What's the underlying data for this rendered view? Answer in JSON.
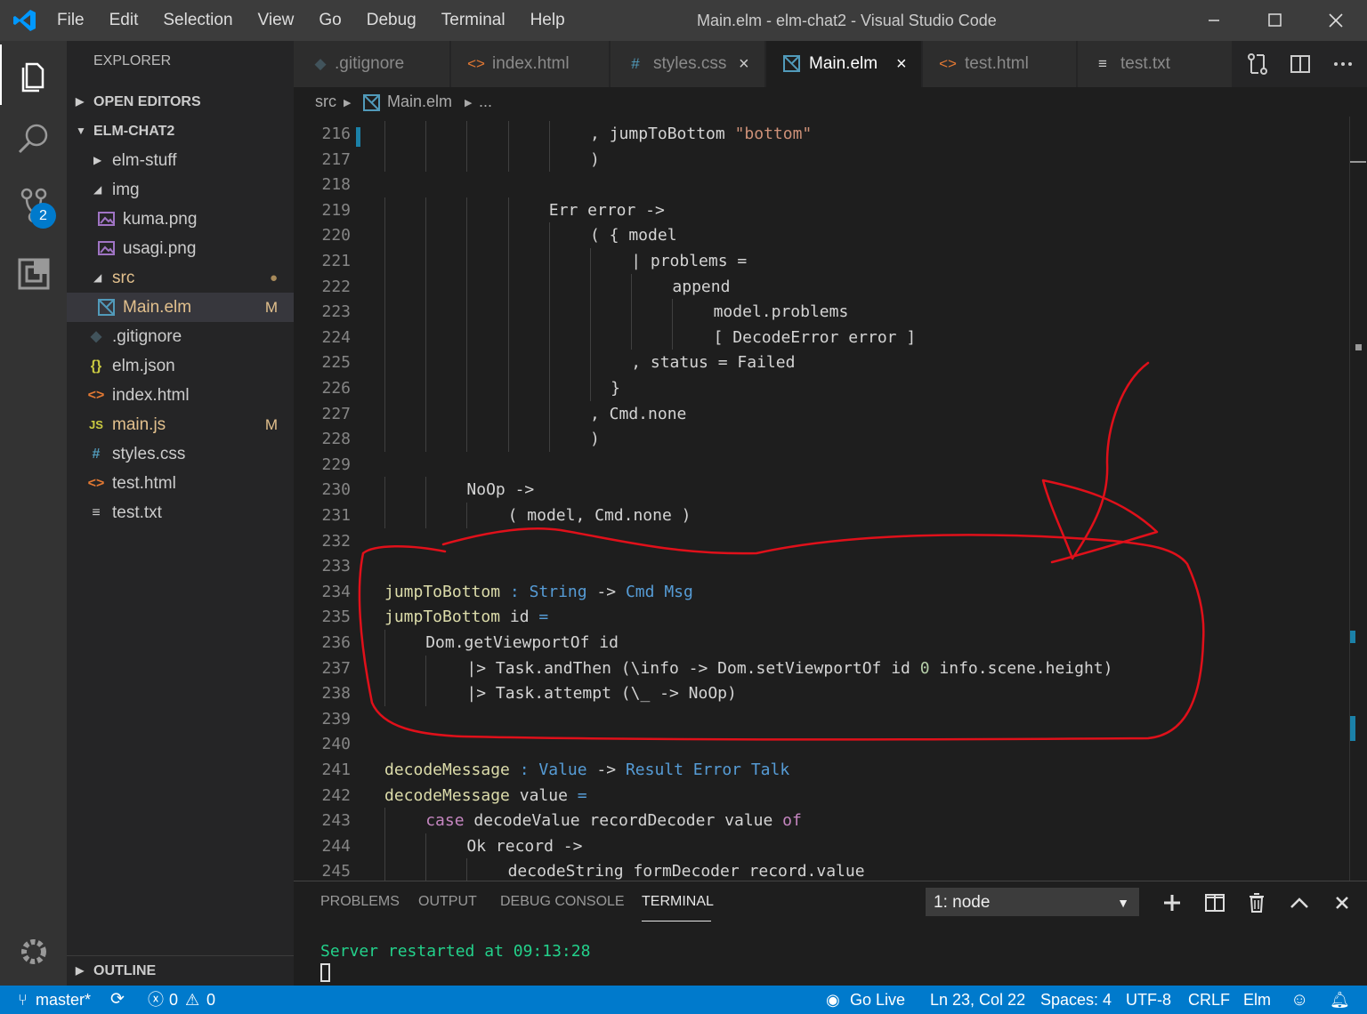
{
  "window": {
    "title": "Main.elm - elm-chat2 - Visual Studio Code"
  },
  "menu": [
    "File",
    "Edit",
    "Selection",
    "View",
    "Go",
    "Debug",
    "Terminal",
    "Help"
  ],
  "activity": {
    "scm_badge": "2"
  },
  "sidebar": {
    "header": "EXPLORER",
    "open_editors": "OPEN EDITORS",
    "project": "ELM-CHAT2",
    "outline": "OUTLINE",
    "tree": [
      {
        "name": "elm-stuff",
        "icon": "folder"
      },
      {
        "name": "img",
        "icon": "folder-open"
      },
      {
        "name": "kuma.png",
        "icon": "image-icon"
      },
      {
        "name": "usagi.png",
        "icon": "image-icon"
      },
      {
        "name": "src",
        "icon": "folder-open",
        "status": "●"
      },
      {
        "name": "Main.elm",
        "icon": "elm-icon",
        "status": "M"
      },
      {
        "name": ".gitignore",
        "icon": "git-icon"
      },
      {
        "name": "elm.json",
        "icon": "json-icon",
        "glyph": "{}"
      },
      {
        "name": "index.html",
        "icon": "html-icon",
        "glyph": "<>"
      },
      {
        "name": "main.js",
        "icon": "js-icon",
        "glyph": "JS",
        "status": "M"
      },
      {
        "name": "styles.css",
        "icon": "css-icon",
        "glyph": "#"
      },
      {
        "name": "test.html",
        "icon": "html-icon",
        "glyph": "<>"
      },
      {
        "name": "test.txt",
        "icon": "text-icon",
        "glyph": "≡"
      }
    ]
  },
  "tabs": [
    {
      "label": ".gitignore",
      "glyph": "◆"
    },
    {
      "label": "index.html",
      "glyph": "<>"
    },
    {
      "label": "styles.css",
      "glyph": "#",
      "close": "×"
    },
    {
      "label": "Main.elm",
      "glyph": "",
      "close": "×"
    },
    {
      "label": "test.html",
      "glyph": "<>"
    },
    {
      "label": "test.txt",
      "glyph": "≡"
    }
  ],
  "breadcrumb": {
    "folder": "src",
    "file": "Main.elm",
    "more": "..."
  },
  "editor": {
    "lines": [
      {
        "n": "216",
        "indent": 10,
        "parts": [
          [
            ", ",
            ""
          ],
          [
            "jumpToBottom",
            ""
          ],
          [
            " ",
            ""
          ],
          [
            "\"bottom\"",
            "s"
          ]
        ]
      },
      {
        "n": "217",
        "indent": 10,
        "parts": [
          [
            ")",
            ""
          ]
        ]
      },
      {
        "n": "218",
        "indent": 0,
        "parts": []
      },
      {
        "n": "219",
        "indent": 8,
        "parts": [
          [
            "Err",
            ""
          ],
          [
            " error ->",
            ""
          ]
        ]
      },
      {
        "n": "220",
        "indent": 10,
        "parts": [
          [
            "( { model",
            ""
          ]
        ]
      },
      {
        "n": "221",
        "indent": 12,
        "parts": [
          [
            "| problems =",
            ""
          ]
        ]
      },
      {
        "n": "222",
        "indent": 14,
        "parts": [
          [
            "append",
            ""
          ]
        ]
      },
      {
        "n": "223",
        "indent": 16,
        "parts": [
          [
            "model.problems",
            ""
          ]
        ]
      },
      {
        "n": "224",
        "indent": 16,
        "parts": [
          [
            "[ DecodeError error ]",
            ""
          ]
        ]
      },
      {
        "n": "225",
        "indent": 12,
        "parts": [
          [
            ", status = Failed",
            ""
          ]
        ]
      },
      {
        "n": "226",
        "indent": 11,
        "parts": [
          [
            "}",
            ""
          ]
        ]
      },
      {
        "n": "227",
        "indent": 10,
        "parts": [
          [
            ", Cmd.none",
            ""
          ]
        ]
      },
      {
        "n": "228",
        "indent": 10,
        "parts": [
          [
            ")",
            ""
          ]
        ]
      },
      {
        "n": "229",
        "indent": 0,
        "parts": []
      },
      {
        "n": "230",
        "indent": 4,
        "parts": [
          [
            "NoOp ->",
            ""
          ]
        ]
      },
      {
        "n": "231",
        "indent": 6,
        "parts": [
          [
            "( model, Cmd.none )",
            ""
          ]
        ]
      },
      {
        "n": "232",
        "indent": 0,
        "parts": []
      },
      {
        "n": "233",
        "indent": 0,
        "parts": []
      },
      {
        "n": "234",
        "indent": 0,
        "parts": [
          [
            "jumpToBottom",
            "f"
          ],
          [
            " : ",
            "ty"
          ],
          [
            "String",
            "ty"
          ],
          [
            " -> ",
            ""
          ],
          [
            "Cmd",
            "ty"
          ],
          [
            " ",
            ""
          ],
          [
            "Msg",
            "ty"
          ]
        ]
      },
      {
        "n": "235",
        "indent": 0,
        "parts": [
          [
            "jumpToBottom",
            "f"
          ],
          [
            " id ",
            ""
          ],
          [
            "=",
            "ty"
          ]
        ]
      },
      {
        "n": "236",
        "indent": 2,
        "parts": [
          [
            "Dom.getViewportOf id",
            ""
          ]
        ]
      },
      {
        "n": "237",
        "indent": 4,
        "parts": [
          [
            "|> Task.andThen (\\info -> Dom.setViewportOf id ",
            ""
          ],
          [
            "0",
            "n"
          ],
          [
            " info.scene.height)",
            ""
          ]
        ]
      },
      {
        "n": "238",
        "indent": 4,
        "parts": [
          [
            "|> Task.attempt (\\_ -> NoOp)",
            ""
          ]
        ]
      },
      {
        "n": "239",
        "indent": 0,
        "parts": []
      },
      {
        "n": "240",
        "indent": 0,
        "parts": []
      },
      {
        "n": "241",
        "indent": 0,
        "parts": [
          [
            "decodeMessage",
            "f"
          ],
          [
            " : ",
            "ty"
          ],
          [
            "Value",
            "ty"
          ],
          [
            " -> ",
            ""
          ],
          [
            "Result Error Talk",
            "ty"
          ]
        ]
      },
      {
        "n": "242",
        "indent": 0,
        "parts": [
          [
            "decodeMessage",
            "f"
          ],
          [
            " value ",
            ""
          ],
          [
            "=",
            "ty"
          ]
        ]
      },
      {
        "n": "243",
        "indent": 2,
        "parts": [
          [
            "case",
            "k"
          ],
          [
            " decodeValue recordDecoder value ",
            ""
          ],
          [
            "of",
            "k"
          ]
        ]
      },
      {
        "n": "244",
        "indent": 4,
        "parts": [
          [
            "Ok record ->",
            ""
          ]
        ]
      },
      {
        "n": "245",
        "indent": 6,
        "parts": [
          [
            "decodeString formDecoder record.value",
            ""
          ]
        ]
      }
    ]
  },
  "panel": {
    "tabs": [
      "PROBLEMS",
      "OUTPUT",
      "DEBUG CONSOLE",
      "TERMINAL"
    ],
    "terminal_select": "1: node",
    "terminal_output": "Server restarted at 09:13:28"
  },
  "statusbar": {
    "branch": "master*",
    "errors": "0",
    "warnings": "0",
    "golive": "Go Live",
    "position": "Ln 23, Col 22",
    "spaces": "Spaces: 4",
    "encoding": "UTF-8",
    "eol": "CRLF",
    "language": "Elm"
  },
  "colors": {
    "accent": "#007acc",
    "annotation": "#e0101a"
  }
}
